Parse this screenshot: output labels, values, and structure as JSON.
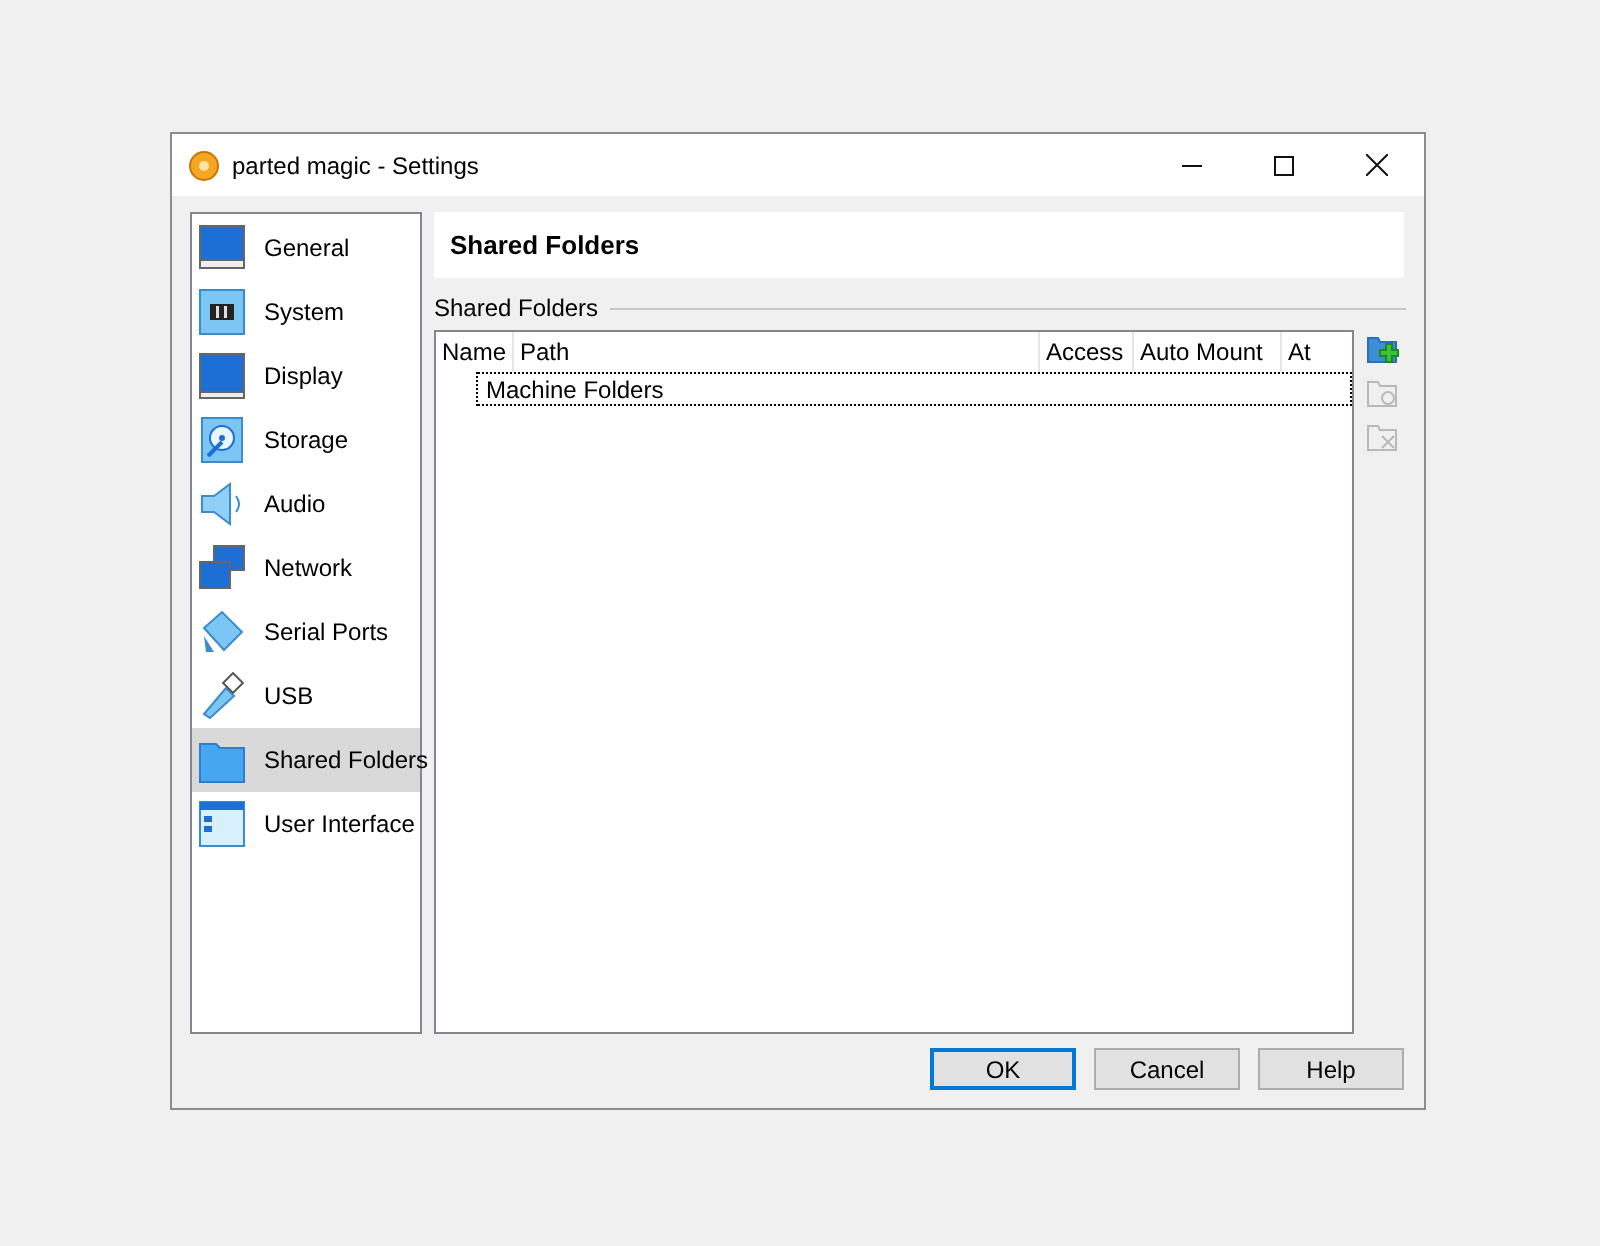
{
  "window": {
    "title": "parted magic - Settings"
  },
  "sidebar": {
    "items": [
      {
        "label": "General",
        "kind": "general",
        "selected": false
      },
      {
        "label": "System",
        "kind": "system",
        "selected": false
      },
      {
        "label": "Display",
        "kind": "display",
        "selected": false
      },
      {
        "label": "Storage",
        "kind": "storage",
        "selected": false
      },
      {
        "label": "Audio",
        "kind": "audio",
        "selected": false
      },
      {
        "label": "Network",
        "kind": "network",
        "selected": false
      },
      {
        "label": "Serial Ports",
        "kind": "serial",
        "selected": false
      },
      {
        "label": "USB",
        "kind": "usb",
        "selected": false
      },
      {
        "label": "Shared Folders",
        "kind": "folder",
        "selected": true
      },
      {
        "label": "User Interface",
        "kind": "ui",
        "selected": false
      }
    ]
  },
  "page": {
    "title": "Shared Folders",
    "group_label": "Shared Folders",
    "table": {
      "columns": [
        "Name",
        "Path",
        "Access",
        "Auto Mount",
        "At"
      ],
      "rows": [
        {
          "label": "Machine Folders",
          "focused": true
        }
      ]
    },
    "tools": [
      {
        "kind": "add",
        "disabled": false
      },
      {
        "kind": "edit",
        "disabled": true
      },
      {
        "kind": "remove",
        "disabled": true
      }
    ]
  },
  "buttons": [
    {
      "label": "OK",
      "default": true
    },
    {
      "label": "Cancel",
      "default": false
    },
    {
      "label": "Help",
      "default": false
    }
  ]
}
